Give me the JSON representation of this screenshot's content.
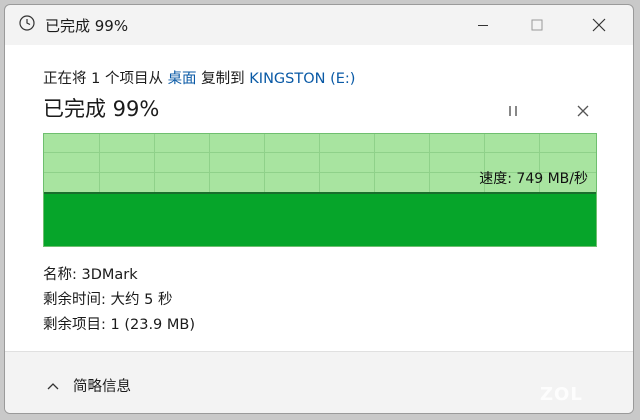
{
  "window": {
    "title": "已完成 99%"
  },
  "progress": {
    "copy_prefix": "正在将 1 个项目从",
    "source": "桌面",
    "copy_middle": "复制到",
    "destination": "KINGSTON (E:)",
    "completed_label": "已完成 99%",
    "percent": 99,
    "speed_label": "速度: 749 MB/秒"
  },
  "details": {
    "name_label": "名称:",
    "name_value": "3DMark",
    "time_label": "剩余时间:",
    "time_value": "大约 5 秒",
    "items_label": "剩余项目:",
    "items_value": "1 (23.9 MB)"
  },
  "footer": {
    "summary_label": "简略信息"
  },
  "watermark": {
    "text": "ZOL"
  },
  "colors": {
    "graph_bg": "#a8e4a0",
    "graph_fill": "#06a52a",
    "link": "#0a5aa6"
  },
  "icons": {
    "app": "clock-icon",
    "pause": "pause-icon",
    "cancel": "close-icon",
    "summary": "chevron-up-icon"
  }
}
